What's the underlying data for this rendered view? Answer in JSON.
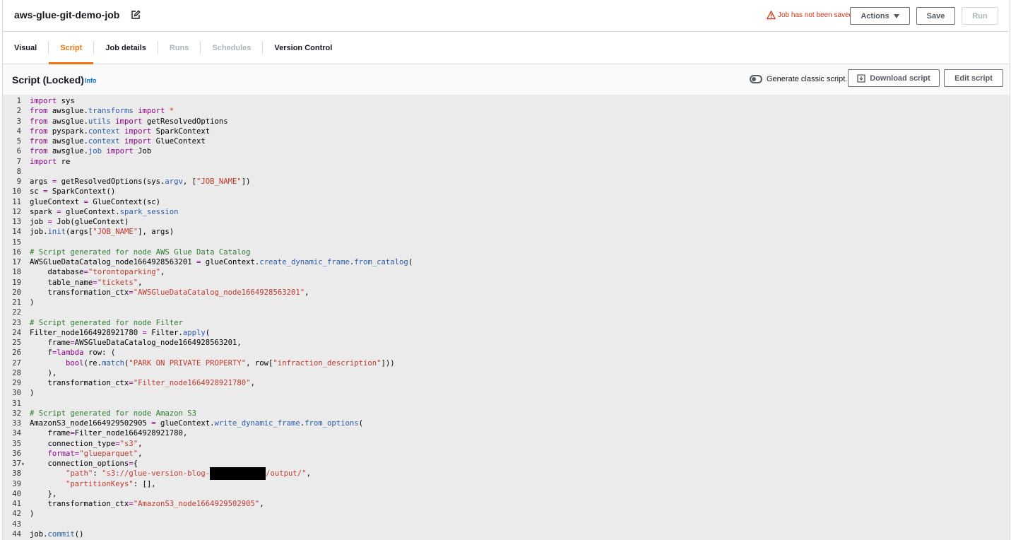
{
  "header": {
    "title": "aws-glue-git-demo-job",
    "warning": "Job has not been saved",
    "actions_label": "Actions",
    "save_label": "Save",
    "run_label": "Run"
  },
  "tabs": [
    {
      "label": "Visual",
      "state": "normal"
    },
    {
      "label": "Script",
      "state": "active"
    },
    {
      "label": "Job details",
      "state": "normal"
    },
    {
      "label": "Runs",
      "state": "disabled"
    },
    {
      "label": "Schedules",
      "state": "disabled"
    },
    {
      "label": "Version Control",
      "state": "normal"
    }
  ],
  "panel": {
    "title": "Script (Locked)",
    "info": "Info",
    "toggle_label": "Generate classic script.",
    "download_label": "Download script",
    "edit_label": "Edit script"
  },
  "colors": {
    "accent": "#ec7211",
    "warning": "#d13212",
    "link": "#0073bb"
  },
  "code_lines": [
    "[[k:import]] sys",
    "[[k:from]] awsglue.[[a:transforms]] [[k:import]] [[s:*]]",
    "[[k:from]] awsglue.[[a:utils]] [[k:import]] getResolvedOptions",
    "[[k:from]] pyspark.[[a:context]] [[k:import]] SparkContext",
    "[[k:from]] awsglue.[[a:context]] [[k:import]] GlueContext",
    "[[k:from]] awsglue.[[a:job]] [[k:import]] Job",
    "[[k:import]] re",
    "",
    "args [[k:=]] getResolvedOptions(sys.[[a:argv]], [[[s:\"JOB_NAME\"]]])",
    "sc [[k:=]] SparkContext()",
    "glueContext [[k:=]] GlueContext(sc)",
    "spark [[k:=]] glueContext.[[a:spark_session]]",
    "job [[k:=]] Job(glueContext)",
    "job.[[a:init]](args[[[s:\"JOB_NAME\"]]], args)",
    "",
    "[[c:# Script generated for node AWS Glue Data Catalog]]",
    "AWSGlueDataCatalog_node1664928563201 [[k:=]] glueContext.[[a:create_dynamic_frame]].[[a:from_catalog]](",
    "    database[[k:=]][[s:\"torontoparking\"]],",
    "    table_name[[k:=]][[s:\"tickets\"]],",
    "    transformation_ctx[[k:=]][[s:\"AWSGlueDataCatalog_node1664928563201\"]],",
    ")",
    "",
    "[[c:# Script generated for node Filter]]",
    "Filter_node1664928921780 [[k:=]] Filter.[[a:apply]](",
    "    frame[[k:=]]AWSGlueDataCatalog_node1664928563201,",
    "    f[[k:=]][[k:lambda]] row: (",
    "        [[k:bool]](re.[[a:match]]([[s:\"PARK ON PRIVATE PROPERTY\"]], row[[[s:\"infraction_description\"]]]))",
    "    ),",
    "    transformation_ctx[[k:=]][[s:\"Filter_node1664928921780\"]],",
    ")",
    "",
    "[[c:# Script generated for node Amazon S3]]",
    "AmazonS3_node1664929502905 [[k:=]] glueContext.[[a:write_dynamic_frame]].[[a:from_options]](",
    "    frame[[k:=]]Filter_node1664928921780,",
    "    connection_type[[k:=]][[s:\"s3\"]],",
    "    [[k:format]][[k:=]][[s:\"glueparquet\"]],",
    "    connection_options[[k:=]]{",
    "        [[s:\"path\"]]: [[s:\"s3://glue-version-blog-]][[R]][[s:/output/\"]],",
    "        [[s:\"partitionKeys\"]]: [],",
    "    },",
    "    transformation_ctx[[k:=]][[s:\"AmazonS3_node1664929502905\"]],",
    ")",
    "",
    "job.[[a:commit]]()"
  ],
  "fold_marker_line": 37
}
